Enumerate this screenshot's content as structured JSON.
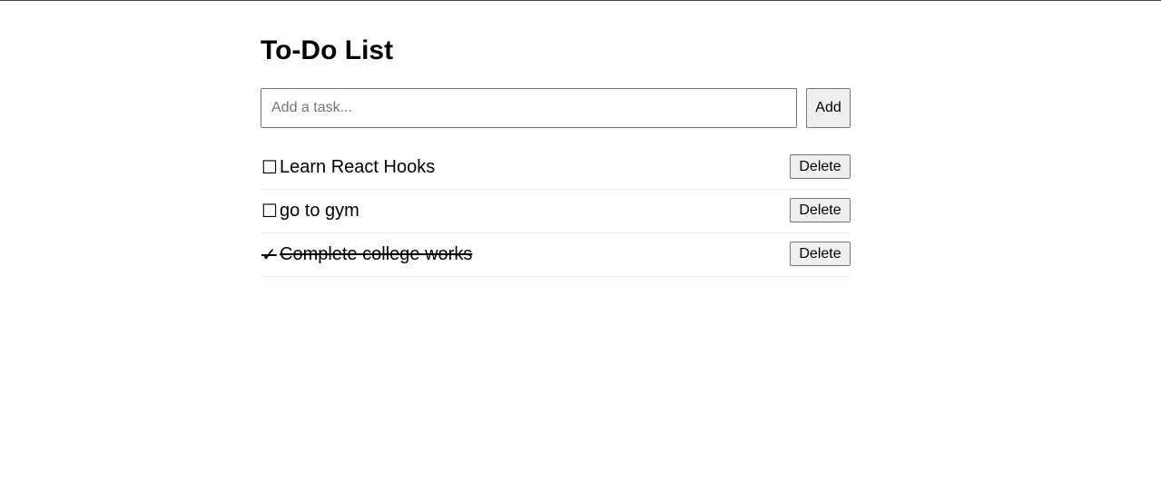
{
  "page": {
    "title": "To-Do List"
  },
  "input": {
    "placeholder": "Add a task...",
    "value": "",
    "add_label": "Add"
  },
  "tasks": [
    {
      "icon": "☐",
      "text": "Learn React Hooks",
      "done": false,
      "delete_label": "Delete"
    },
    {
      "icon": "☐",
      "text": "go to gym",
      "done": false,
      "delete_label": "Delete"
    },
    {
      "icon": "✓",
      "text": "Complete college works",
      "done": true,
      "delete_label": "Delete"
    }
  ]
}
